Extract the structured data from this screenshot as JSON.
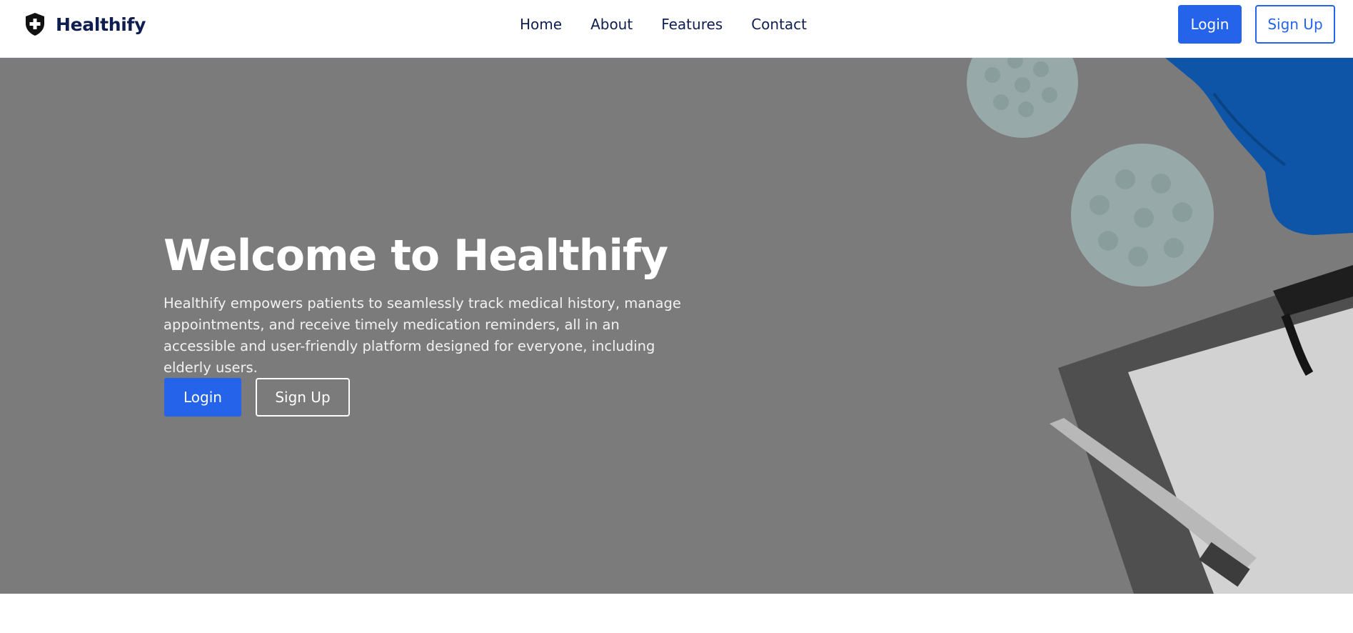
{
  "nav": {
    "brand": "Healthify",
    "links": [
      "Home",
      "About",
      "Features",
      "Contact"
    ],
    "login": "Login",
    "signup": "Sign Up"
  },
  "hero": {
    "title": "Welcome to Healthify",
    "description": "Healthify empowers patients to seamlessly track medical history, manage appointments, and receive timely medication reminders, all in an accessible and user-friendly platform designed for everyone, including elderly users.",
    "login": "Login",
    "signup": "Sign Up"
  },
  "colors": {
    "primary": "#2563eb",
    "navText": "#0e1e4f",
    "heroOverlay": "#7b7b7b"
  },
  "icons": {
    "brand": "shield-plus-icon"
  }
}
